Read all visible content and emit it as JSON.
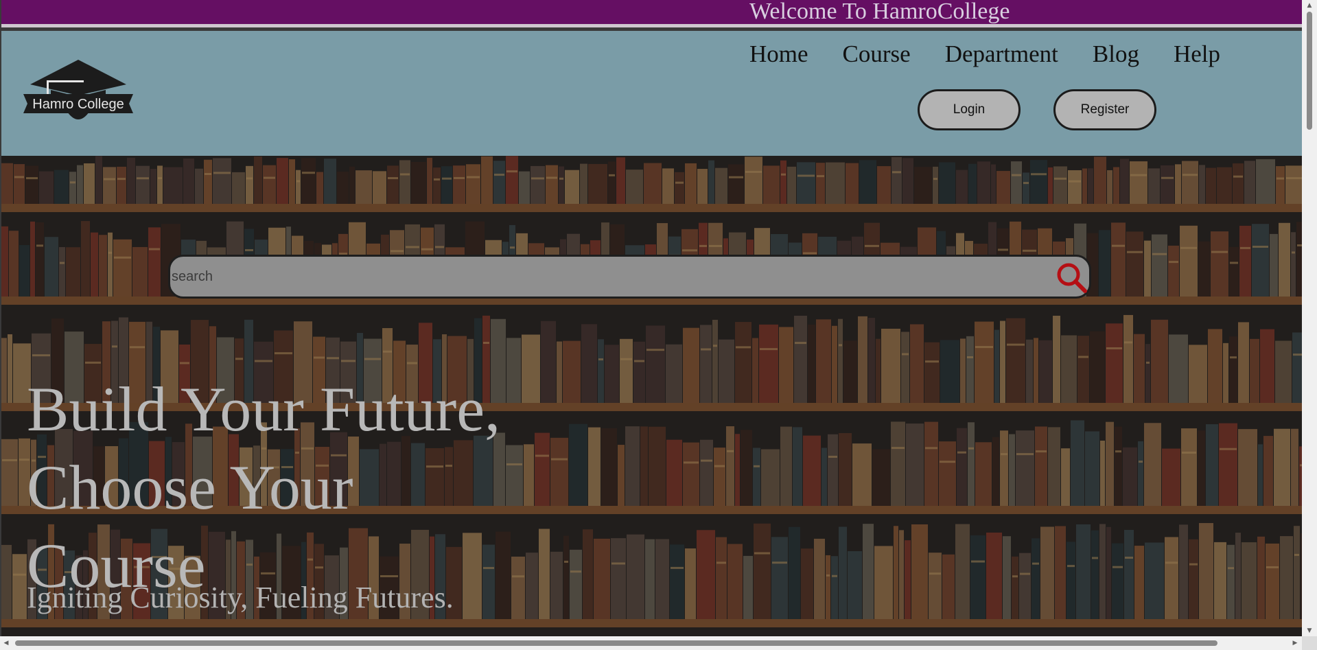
{
  "topbar": {
    "welcome": "Welcome To HamroCollege"
  },
  "header": {
    "logo_text": "Hamro College",
    "nav": [
      "Home",
      "Course",
      "Department",
      "Blog",
      "Help"
    ],
    "login_label": "Login",
    "register_label": "Register"
  },
  "hero": {
    "search_placeholder": "search",
    "headline_line1": "Build Your Future,",
    "headline_line2": "Choose Your",
    "headline_line3": "Course",
    "tagline": "Igniting Curiosity, Fueling Futures.",
    "background": "bookshelf-image"
  },
  "colors": {
    "topbar": "#650f63",
    "header": "#7a9ca7",
    "search_icon": "#b50f14",
    "button": "#b3b3b3"
  },
  "icons": {
    "search": "search-icon",
    "logo": "graduation-cap-logo"
  }
}
